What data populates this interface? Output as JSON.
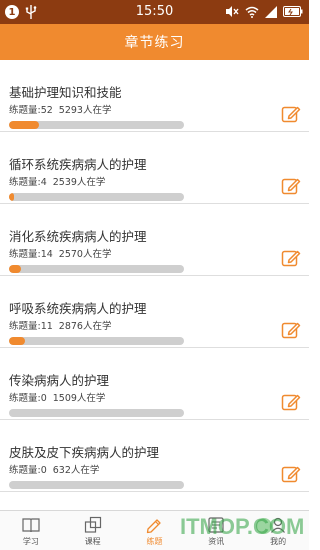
{
  "status_bar": {
    "notification_count": "1",
    "time": "15:50"
  },
  "header": {
    "title": "章节练习"
  },
  "chapters": [
    {
      "title": "基础护理知识和技能",
      "count_label": "练题量:52",
      "learners_label": "5293人在学",
      "progress": 0.17
    },
    {
      "title": "循环系统疾病病人的护理",
      "count_label": "练题量:4",
      "learners_label": "2539人在学",
      "progress": 0.03
    },
    {
      "title": "消化系统疾病病人的护理",
      "count_label": "练题量:14",
      "learners_label": "2570人在学",
      "progress": 0.07
    },
    {
      "title": "呼吸系统疾病病人的护理",
      "count_label": "练题量:11",
      "learners_label": "2876人在学",
      "progress": 0.09
    },
    {
      "title": "传染病病人的护理",
      "count_label": "练题量:0",
      "learners_label": "1509人在学",
      "progress": 0.0
    },
    {
      "title": "皮肤及皮下疾病病人的护理",
      "count_label": "练题量:0",
      "learners_label": "632人在学",
      "progress": 0.0
    }
  ],
  "bottom_nav": [
    {
      "label": "学习",
      "icon": "book-icon",
      "active": false
    },
    {
      "label": "课程",
      "icon": "course-icon",
      "active": false
    },
    {
      "label": "练题",
      "icon": "pencil-icon",
      "active": true
    },
    {
      "label": "资讯",
      "icon": "news-icon",
      "active": false
    },
    {
      "label": "我的",
      "icon": "profile-icon",
      "active": false
    }
  ],
  "watermark": {
    "text": "ITMOP.COM"
  },
  "colors": {
    "accent": "#f08a2f",
    "status_bar": "#8c3b11",
    "track": "#cfcfcf"
  }
}
